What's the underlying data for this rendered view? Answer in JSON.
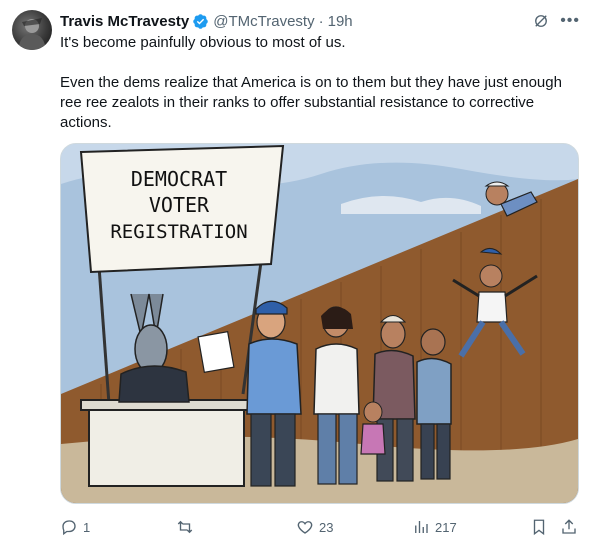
{
  "tweet": {
    "author_name": "Travis McTravesty",
    "handle": "@TMcTravesty",
    "separator": "·",
    "time": "19h",
    "paragraph_1": "It's become painfully obvious to most of us.",
    "paragraph_2": "Even the dems realize that America is on to them but they have just enough ree ree zealots in their ranks to offer substantial resistance to corrective actions."
  },
  "cartoon": {
    "sign_line_1": "DEMOCRAT",
    "sign_line_2": "VOTER",
    "sign_line_3": "REGISTRATION"
  },
  "actions": {
    "reply_count": "1",
    "repost_count": "",
    "like_count": "23",
    "views_count": "217"
  },
  "colors": {
    "verified_blue": "#1d9bf0",
    "secondary_text": "#536471",
    "wall_brown": "#8f5a2e"
  }
}
